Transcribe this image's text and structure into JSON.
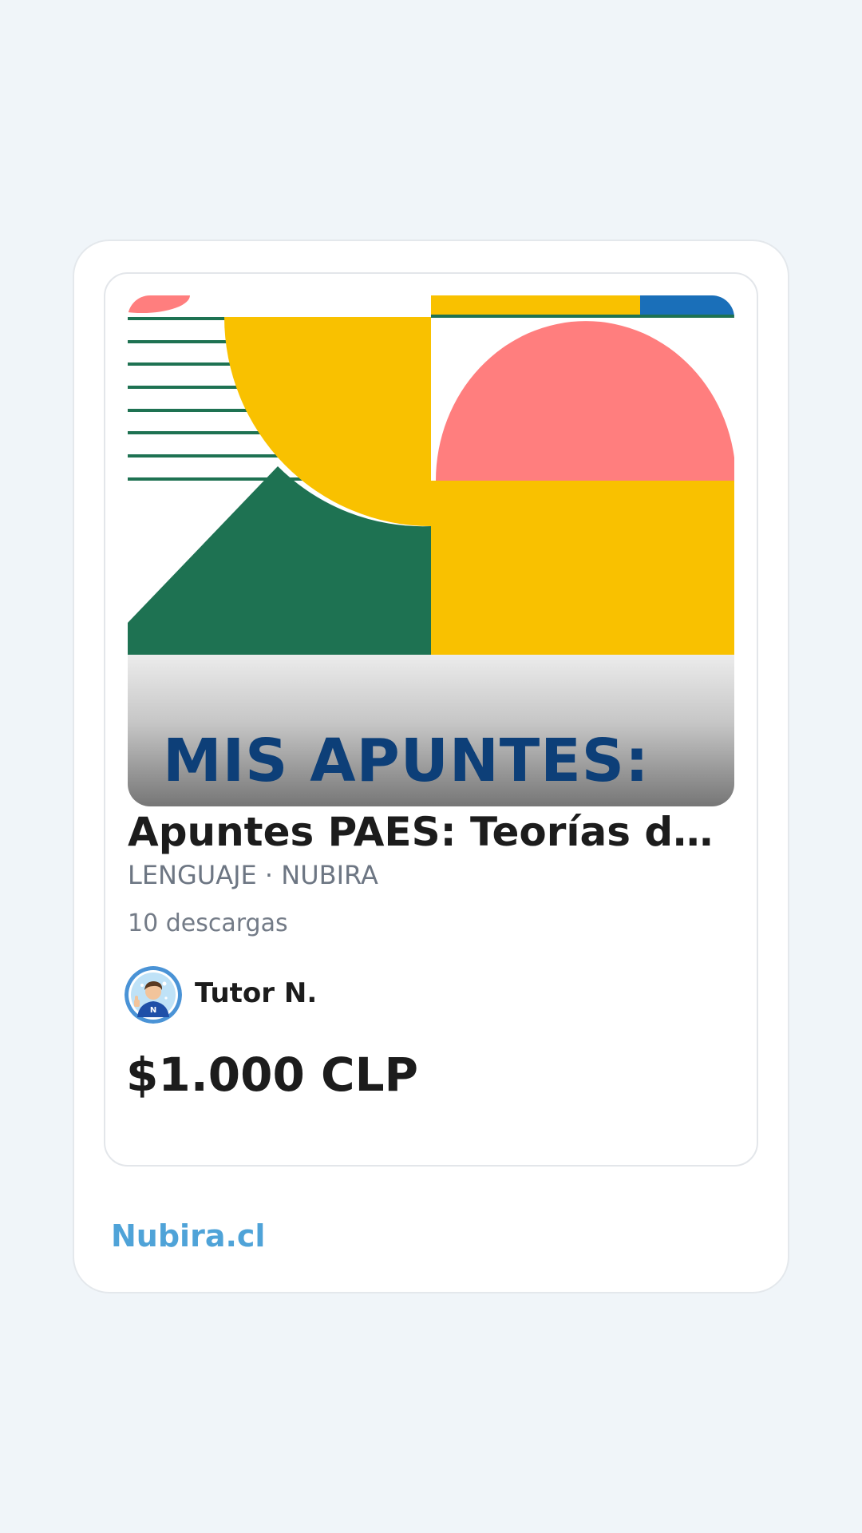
{
  "product": {
    "cover_text": "MIS APUNTES:",
    "title": "Apuntes PAES: Teorías de la...",
    "meta": "LENGUAJE · NUBIRA",
    "downloads": "10 descargas",
    "author": "Tutor N.",
    "price": "$1.000 CLP"
  },
  "footer": {
    "brand": "Nubira.cl"
  },
  "colors": {
    "background": "#f0f5f9",
    "brand": "#4fa3d8",
    "cover_yellow": "#f9c100",
    "cover_green": "#1e7252",
    "cover_pink": "#ff7e7e",
    "cover_blue": "#1a6fb9",
    "cover_text": "#0d3f78"
  },
  "icons": {
    "avatar": "tutor-avatar"
  }
}
